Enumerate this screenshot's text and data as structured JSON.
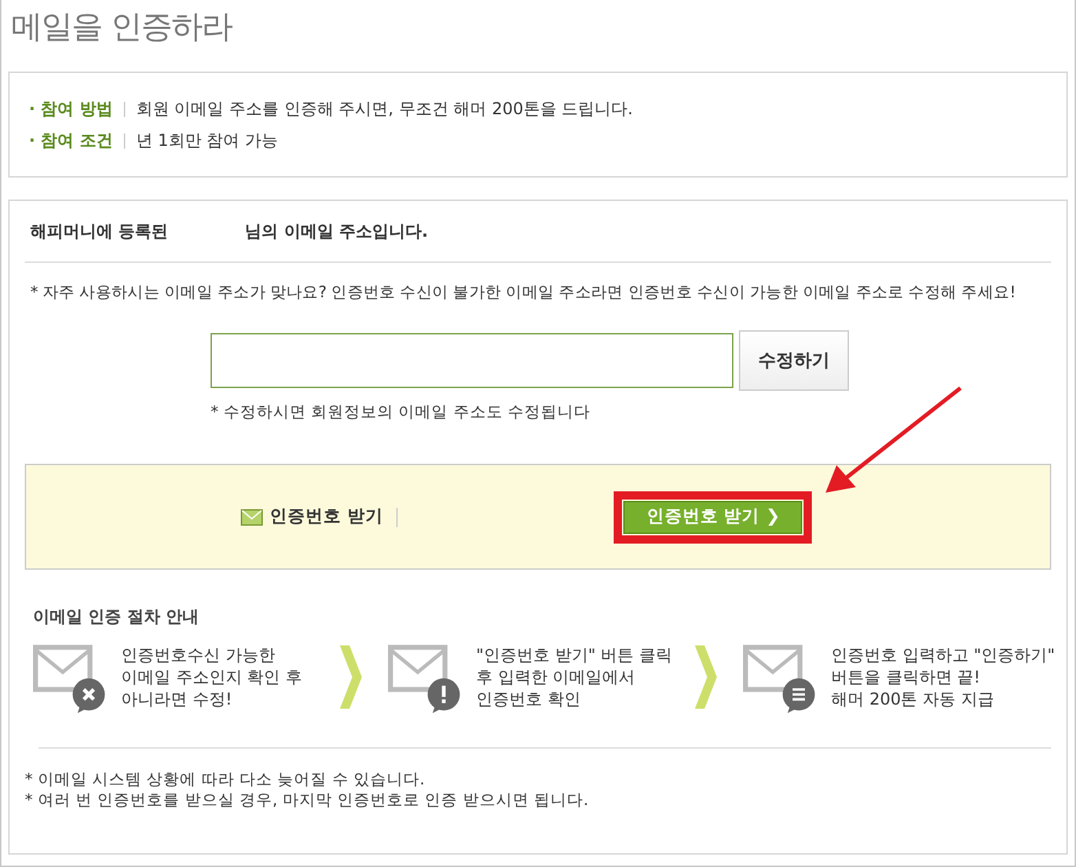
{
  "title": "메일을 인증하라",
  "info": [
    {
      "label": "· 참여 방법",
      "text": "회원 이메일 주소를 인증해 주시면, 무조건 해머 200톤을 드립니다."
    },
    {
      "label": "· 참여 조건",
      "text": "년 1회만 참여 가능"
    }
  ],
  "registered": {
    "prefix": "해피머니에 등록된",
    "suffix": "님의 이메일 주소입니다."
  },
  "notice": "* 자주 사용하시는 이메일 주소가 맞나요? 인증번호 수신이 불가한 이메일 주소라면 인증번호 수신이 가능한 이메일 주소로 수정해 주세요!",
  "edit_button": "수정하기",
  "edit_note": "* 수정하시면 회원정보의 이메일 주소도 수정됩니다",
  "verify": {
    "label": "인증번호 받기",
    "button": "인증번호 받기 ❯"
  },
  "steps_title": "이메일 인증 절차 안내",
  "steps": [
    {
      "kind": "error",
      "lines": [
        "인증번호수신 가능한",
        "이메일 주소인지 확인 후",
        "아니라면 수정!"
      ]
    },
    {
      "kind": "alert",
      "lines": [
        "\"인증번호 받기\" 버튼 클릭",
        "후 입력한 이메일에서",
        "인증번호 확인"
      ]
    },
    {
      "kind": "list",
      "lines": [
        "인증번호 입력하고 \"인증하기\"",
        "버튼을 클릭하면 끝!",
        "해머 200톤 자동 지급"
      ]
    }
  ],
  "footnotes": [
    "* 이메일 시스템 상황에 따라 다소 늦어질 수 있습니다.",
    "* 여러 번 인증번호를 받으실 경우, 마지막 인증번호로 인증 받으시면 됩니다."
  ]
}
